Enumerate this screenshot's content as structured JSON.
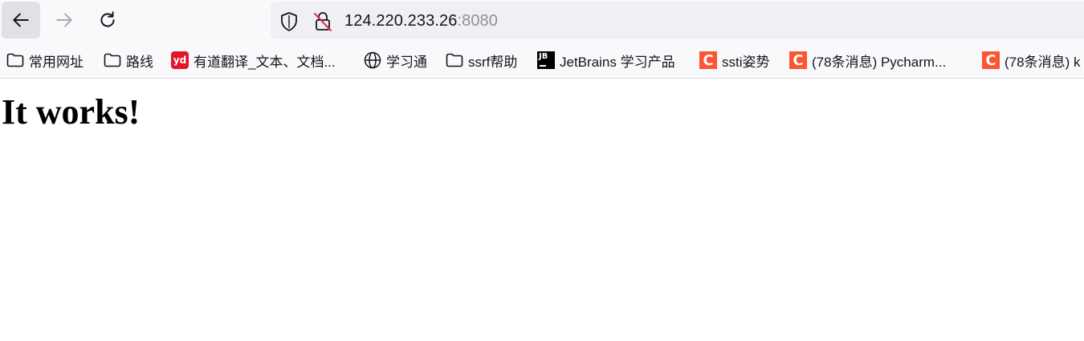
{
  "address_bar": {
    "host": "124.220.233.26",
    "port": ":8080"
  },
  "bookmarks": [
    {
      "label": "常用网址",
      "icon": "folder-icon"
    },
    {
      "label": "路线",
      "icon": "folder-icon"
    },
    {
      "label": "有道翻译_文本、文档...",
      "icon": "youdao-icon",
      "icon_text": "yd"
    },
    {
      "label": "学习通",
      "icon": "globe-icon"
    },
    {
      "label": "ssrf帮助",
      "icon": "folder-icon"
    },
    {
      "label": "JetBrains 学习产品",
      "icon": "jetbrains-icon",
      "icon_text": "JB"
    },
    {
      "label": "ssti姿势",
      "icon": "csdn-icon",
      "icon_text": "C"
    },
    {
      "label": "(78条消息) Pycharm...",
      "icon": "csdn-icon",
      "icon_text": "C"
    },
    {
      "label": "(78条消息) k",
      "icon": "csdn-icon",
      "icon_text": "C"
    }
  ],
  "page": {
    "heading": "It works!"
  },
  "colors": {
    "toolbar_bg": "#f9f9fb",
    "urlbar_bg": "#f0f0f4",
    "port_text": "#8f8f9d",
    "csdn": "#fc5531",
    "youdao": "#e5142d"
  }
}
